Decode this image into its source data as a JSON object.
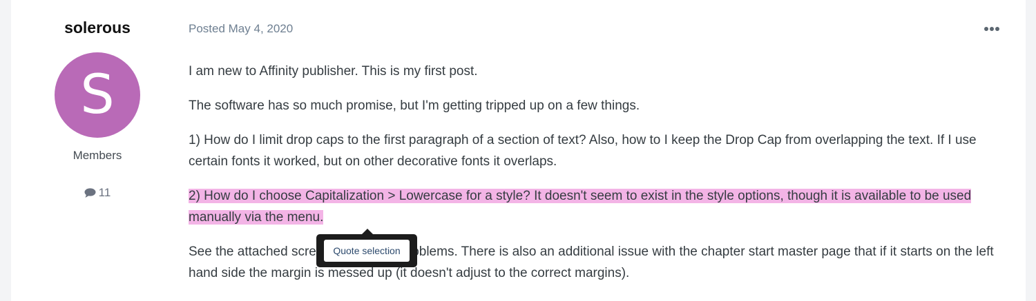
{
  "author": {
    "username": "solerous",
    "avatar_letter": "S",
    "avatar_color": "#b96ab7",
    "group": "Members",
    "post_count": "11",
    "post_count_icon": "comment-icon"
  },
  "post": {
    "posted_label": "Posted May 4, 2020",
    "more_icon": "ellipsis-icon",
    "paragraphs": [
      "I am new to Affinity publisher. This is my first post.",
      "The software has so much promise, but I'm getting tripped up on a few things.",
      "1) How do I limit drop caps to the first paragraph of a section of text? Also, how to I keep the Drop Cap from overlapping the text. If I use certain fonts it worked, but on other decorative fonts it overlaps.",
      "2) How do I choose Capitalization > Lowercase for a style? It doesn't seem to exist in the style options, though it is available to be used manually via the menu.",
      "See the attached screenshot for the problems. There is also an additional issue with the chapter start master page that if it starts on the left hand side the margin is messed up (it doesn't adjust to the correct margins)."
    ],
    "highlight_color": "#f3b4e6"
  },
  "quote_popup": {
    "label": "Quote selection"
  }
}
